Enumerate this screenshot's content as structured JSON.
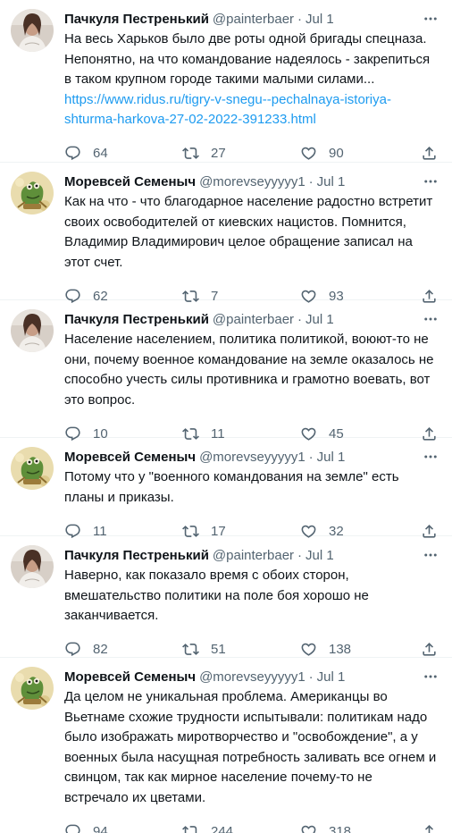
{
  "tweets": [
    {
      "author": "Пачкуля Пестренький",
      "handle": "@painterbaer",
      "date": "Jul 1",
      "avatar": "woman-avatar",
      "text": "На весь Харьков было две роты одной бригады спецназа. Непонятно, на что командование надеялось - закрепиться в таком крупном городе такими малыми силами...",
      "link": "https://www.ridus.ru/tigry-v-snegu--pechalnaya-istoriya-shturma-harkova-27-02-2022-391233.html",
      "replies": "64",
      "retweets": "27",
      "likes": "90"
    },
    {
      "author": "Моревсей Семеныч",
      "handle": "@morevseyyyyy1",
      "date": "Jul 1",
      "avatar": "frog-avatar",
      "text": "Как на что - что благодарное население радостно встретит своих освободителей от киевских нацистов. Помнится, Владимир Владимирович целое обращение записал на этот счет.",
      "replies": "62",
      "retweets": "7",
      "likes": "93"
    },
    {
      "author": "Пачкуля Пестренький",
      "handle": "@painterbaer",
      "date": "Jul 1",
      "avatar": "woman-avatar",
      "text": "Население населением, политика политикой, воюют-то не они, почему военное командование на земле оказалось не способно учесть силы противника и грамотно воевать, вот это вопрос.",
      "replies": "10",
      "retweets": "11",
      "likes": "45"
    },
    {
      "author": "Моревсей Семеныч",
      "handle": "@morevseyyyyy1",
      "date": "Jul 1",
      "avatar": "frog-avatar",
      "text": "Потому что у \"военного командования на земле\" есть планы и приказы.",
      "replies": "11",
      "retweets": "17",
      "likes": "32"
    },
    {
      "author": "Пачкуля Пестренький",
      "handle": "@painterbaer",
      "date": "Jul 1",
      "avatar": "woman-avatar",
      "text": "Наверно, как показало время с обоих сторон, вмешательство политики на поле боя хорошо не заканчивается.",
      "replies": "82",
      "retweets": "51",
      "likes": "138"
    },
    {
      "author": "Моревсей Семеныч",
      "handle": "@morevseyyyyy1",
      "date": "Jul 1",
      "avatar": "frog-avatar",
      "text": "Да целом не уникальная проблема. Американцы во Вьетнаме схожие трудности испытывали: политикам надо было изображать миротворчество и \"освобождение\", а у военных была насущная потребность заливать все огнем и свинцом, так как мирное население почему-то не встречало их цветами.",
      "replies": "94",
      "retweets": "244",
      "likes": "318"
    }
  ],
  "icons": {
    "more": "more-icon",
    "reply": "reply-icon",
    "retweet": "retweet-icon",
    "like": "like-icon",
    "share": "share-icon"
  },
  "colors": {
    "text": "#0f1419",
    "secondary": "#536471",
    "link": "#1d9bf0",
    "divider": "#eff3f4"
  }
}
